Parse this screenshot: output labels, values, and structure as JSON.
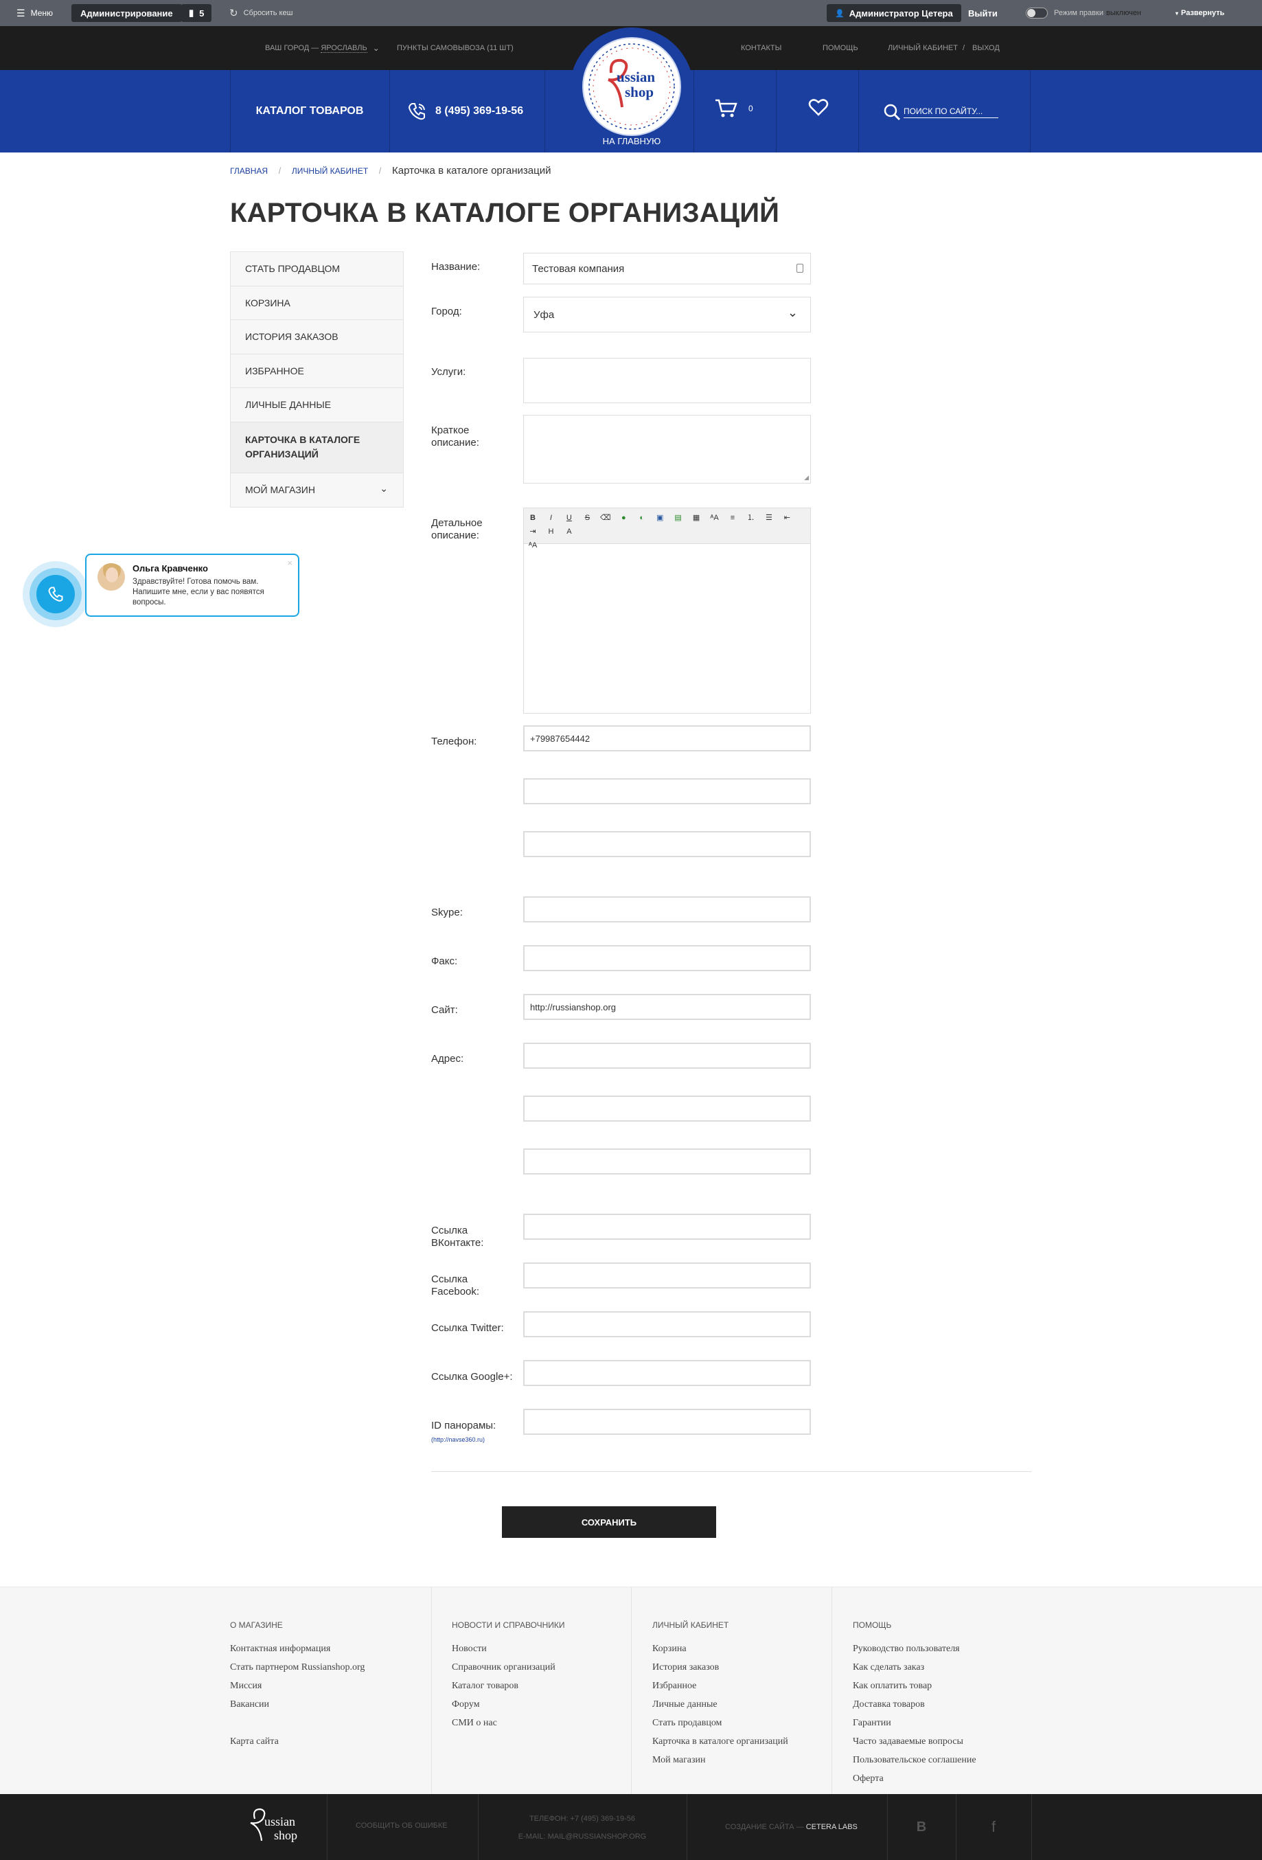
{
  "admin_bar": {
    "menu_label": "Меню",
    "admin_label": "Администрирование",
    "count": "5",
    "reset_cache": "Сбросить кеш",
    "user_label": "Администратор Цетера",
    "logout": "Выйти",
    "edit_mode_label": "Режим правки",
    "edit_mode_state": "выключен",
    "expand": "Развернуть"
  },
  "top_bar": {
    "city_prefix": "Ваш город —",
    "city": "Ярославль",
    "pickup": "Пункты самовывоза (11 шт)",
    "contacts": "Контакты",
    "help": "Помощь",
    "cabinet": "Личный кабинет",
    "sep": "/",
    "exit": "Выход"
  },
  "header": {
    "catalog": "Каталог товаров",
    "phone": "8 (495) 369-19-56",
    "logo_line1": "ussian",
    "logo_line2": "shop",
    "home": "НА ГЛАВНУЮ",
    "cart_count": "0",
    "search_placeholder": "ПОИСК ПО САЙТУ..."
  },
  "breadcrumbs": [
    "Главная",
    "Личный кабинет",
    "Карточка в каталоге организаций"
  ],
  "page_title": "КАРТОЧКА В КАТАЛОГЕ ОРГАНИЗАЦИЙ",
  "sidebar": {
    "items": [
      "Стать продавцом",
      "Корзина",
      "История заказов",
      "Избранное",
      "Личные данные",
      "Карточка в каталоге организаций",
      "Мой магазин"
    ]
  },
  "form": {
    "name_label": "Название:",
    "name_value": "Тестовая компания",
    "city_label": "Город:",
    "city_value": "Уфа",
    "services_label": "Услуги:",
    "short_desc_label": "Краткое описание:",
    "detail_desc_label": "Детальное описание:",
    "phone_label": "Телефон:",
    "phone_value": "+79987654442",
    "skype_label": "Skype:",
    "fax_label": "Факс:",
    "site_label": "Сайт:",
    "site_value": "http://russianshop.org",
    "address_label": "Адрес:",
    "vk_label": "Ссылка ВКонтакте:",
    "fb_label": "Ссылка Facebook:",
    "tw_label": "Ссылка Twitter:",
    "gplus_label": "Ссылка Google+:",
    "pano_label": "ID панорамы:",
    "pano_hint": "(http://navse360.ru)",
    "save": "Сохранить"
  },
  "chat": {
    "name": "Ольга Кравченко",
    "text": "Здравствуйте! Готова помочь вам. Напишите мне, если у вас появятся вопросы."
  },
  "footer": {
    "col1": {
      "title": "О магазине",
      "links": [
        "Контактная информация",
        "Стать партнером Russianshop.org",
        "Миссия",
        "Вакансии"
      ],
      "extra": "Карта сайта"
    },
    "col2": {
      "title": "Новости и справочники",
      "links": [
        "Новости",
        "Справочник организаций",
        "Каталог товаров",
        "Форум",
        "СМИ о нас"
      ]
    },
    "col3": {
      "title": "Личный кабинет",
      "links": [
        "Корзина",
        "История заказов",
        "Избранное",
        "Личные данные",
        "Стать продавцом",
        "Карточка в каталоге организаций",
        "Мой магазин"
      ]
    },
    "col4": {
      "title": "Помощь",
      "links": [
        "Руководство пользователя",
        "Как сделать заказ",
        "Как оплатить товар",
        "Доставка товаров",
        "Гарантии",
        "Часто задаваемые вопросы",
        "Пользовательское соглашение",
        "Оферта"
      ]
    },
    "report": "Сообщить об ошибке",
    "phone": "Телефон: +7 (495) 369-19-56",
    "email": "E-mail: mail@russianshop.org",
    "made_by": "Создание сайта —",
    "made_by_name": "Cetera labs",
    "vk": "В",
    "fb": "f",
    "logo_line1": "ussian",
    "logo_line2": "shop"
  }
}
